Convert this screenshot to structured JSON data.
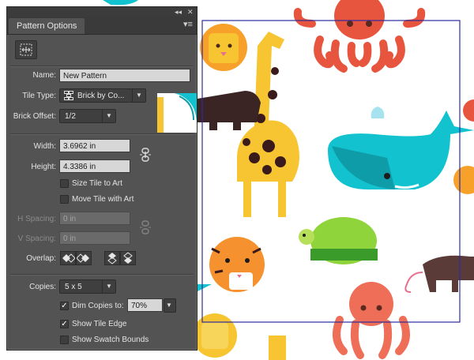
{
  "panel": {
    "collapse_glyph": "◂◂",
    "close_glyph": "✕",
    "title": "Pattern Options",
    "menu_glyph": "▾≡",
    "tool_icon": "tile-editor-tool-icon"
  },
  "fields": {
    "name_label": "Name:",
    "name_value": "New Pattern",
    "tile_type_label": "Tile Type:",
    "tile_type_value": "Brick by Co...",
    "brick_offset_label": "Brick Offset:",
    "brick_offset_value": "1/2",
    "width_label": "Width:",
    "width_value": "3.6962 in",
    "height_label": "Height:",
    "height_value": "4.3386 in",
    "size_tile_to_art": "Size Tile to Art",
    "move_tile_with_art": "Move Tile with Art",
    "h_spacing_label": "H Spacing:",
    "h_spacing_value": "0 in",
    "v_spacing_label": "V Spacing:",
    "v_spacing_value": "0 in",
    "overlap_label": "Overlap:",
    "copies_label": "Copies:",
    "copies_value": "5 x 5",
    "dim_copies_label": "Dim Copies to:",
    "dim_copies_value": "70%",
    "show_tile_edge": "Show Tile Edge",
    "show_swatch_bounds": "Show Swatch Bounds"
  },
  "checks": {
    "size_tile_to_art": false,
    "move_tile_with_art": false,
    "dim_copies": true,
    "show_tile_edge": true,
    "show_swatch_bounds": false
  },
  "colors": {
    "tile_edge": "#2b2b9e",
    "panel_bg": "#535353",
    "giraffe": "#f7c531",
    "whale": "#12c2cf",
    "octopus": "#e8553e",
    "turtle": "#8fd43a",
    "tiger": "#f5922f",
    "lion": "#f7c531",
    "tapir": "#5a3b38"
  }
}
